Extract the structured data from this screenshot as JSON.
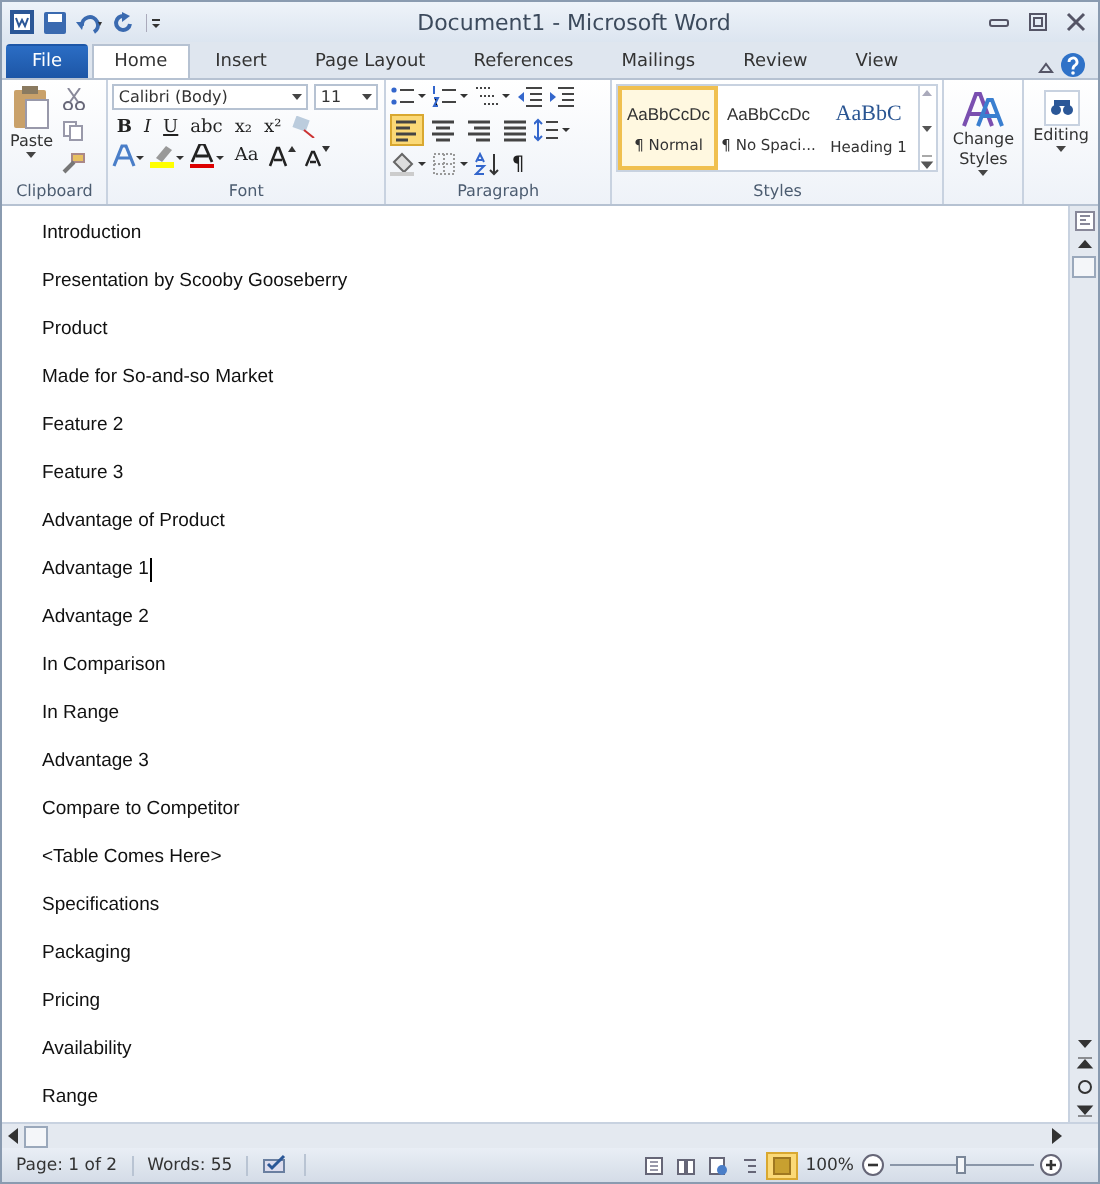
{
  "window": {
    "title": "Document1 - Microsoft Word"
  },
  "tabs": [
    {
      "label": "File",
      "kind": "file",
      "selected": false
    },
    {
      "label": "Home",
      "kind": "tab",
      "selected": true
    },
    {
      "label": "Insert",
      "kind": "tab",
      "selected": false
    },
    {
      "label": "Page Layout",
      "kind": "tab",
      "selected": false
    },
    {
      "label": "References",
      "kind": "tab",
      "selected": false
    },
    {
      "label": "Mailings",
      "kind": "tab",
      "selected": false
    },
    {
      "label": "Review",
      "kind": "tab",
      "selected": false
    },
    {
      "label": "View",
      "kind": "tab",
      "selected": false
    }
  ],
  "ribbon": {
    "clipboard": {
      "label": "Clipboard",
      "paste": "Paste"
    },
    "font": {
      "label": "Font",
      "family": "Calibri (Body)",
      "size": "11",
      "format_buttons": [
        "B",
        "I",
        "U",
        "abc",
        "x₂",
        "x²"
      ],
      "case_button": "Aa"
    },
    "paragraph": {
      "label": "Paragraph",
      "pilcrow": "¶",
      "alignments": [
        {
          "kind": "left",
          "selected": true
        },
        {
          "kind": "center",
          "selected": false
        },
        {
          "kind": "right",
          "selected": false
        },
        {
          "kind": "justify",
          "selected": false
        }
      ]
    },
    "styles": {
      "label": "Styles",
      "items": [
        {
          "preview": "AaBbCcDc",
          "name": "¶ Normal",
          "kind": "normal",
          "selected": true
        },
        {
          "preview": "AaBbCcDc",
          "name": "¶ No Spaci...",
          "kind": "normal",
          "selected": false
        },
        {
          "preview": "AaBbC",
          "name": "Heading 1",
          "kind": "heading",
          "selected": false
        }
      ]
    },
    "change_styles": [
      "Change",
      "Styles"
    ],
    "editing": "Editing"
  },
  "document": {
    "paragraphs": [
      {
        "text": "Introduction",
        "cursor": false
      },
      {
        "text": "Presentation by Scooby Gooseberry",
        "cursor": false
      },
      {
        "text": "Product",
        "cursor": false
      },
      {
        "text": "Made for So-and-so Market",
        "cursor": false
      },
      {
        "text": "Feature 2",
        "cursor": false
      },
      {
        "text": "Feature 3",
        "cursor": false
      },
      {
        "text": "Advantage of Product",
        "cursor": false
      },
      {
        "text": "Advantage 1",
        "cursor": true
      },
      {
        "text": "Advantage 2",
        "cursor": false
      },
      {
        "text": "In Comparison",
        "cursor": false
      },
      {
        "text": "In Range",
        "cursor": false
      },
      {
        "text": "Advantage 3",
        "cursor": false
      },
      {
        "text": "Compare to Competitor",
        "cursor": false
      },
      {
        "text": "<Table Comes Here>",
        "cursor": false
      },
      {
        "text": "Specifications",
        "cursor": false
      },
      {
        "text": "Packaging",
        "cursor": false
      },
      {
        "text": "Pricing",
        "cursor": false
      },
      {
        "text": "Availability",
        "cursor": false
      },
      {
        "text": "Range",
        "cursor": false
      }
    ]
  },
  "status_bar": {
    "page": "Page: 1 of 2",
    "words": "Words: 55",
    "views": [
      {
        "kind": "print",
        "selected": false
      },
      {
        "kind": "reading",
        "selected": false
      },
      {
        "kind": "web",
        "selected": false
      },
      {
        "kind": "outline",
        "selected": false
      },
      {
        "kind": "draft",
        "selected": true
      }
    ],
    "zoom": "100%",
    "zoom_level": {
      "level": 0.5
    }
  }
}
